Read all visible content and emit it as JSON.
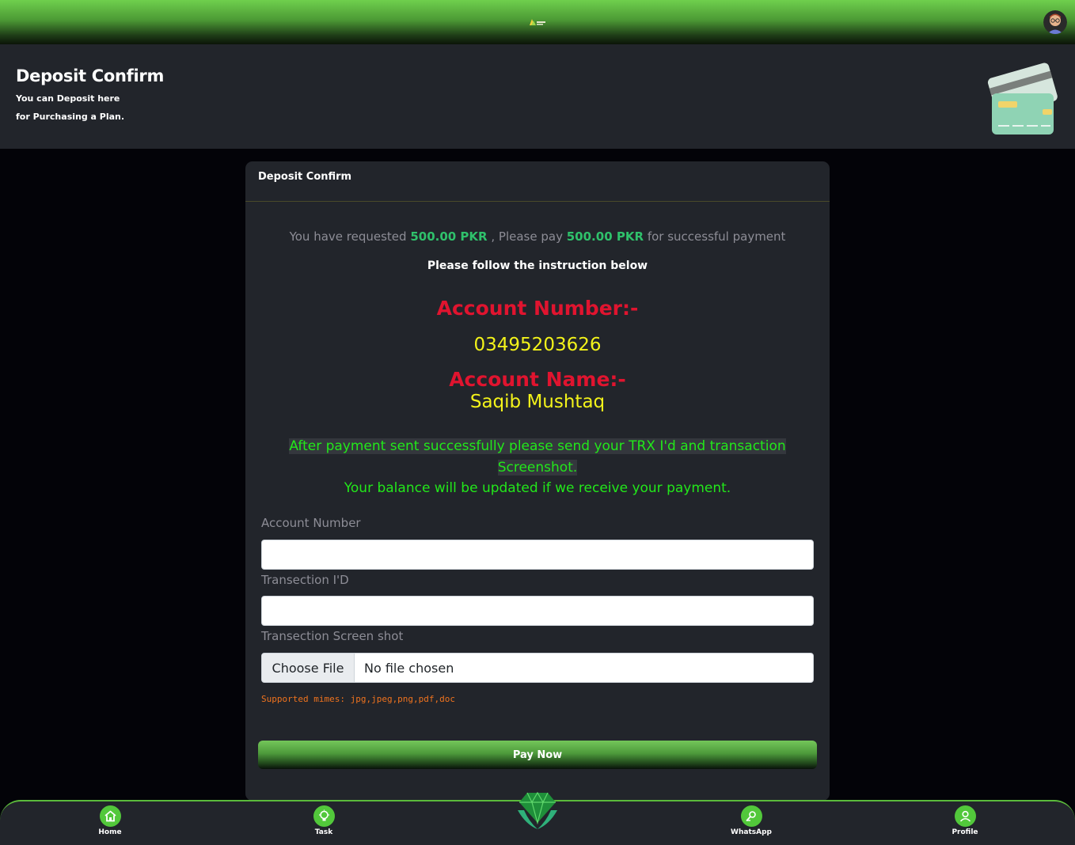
{
  "header": {
    "logo_icon": "brand-logo-icon",
    "avatar_icon": "user-avatar-icon",
    "accent_color": "#5cb83f"
  },
  "banner": {
    "title": "Deposit Confirm",
    "subtitle_line1": "You can Deposit here",
    "subtitle_line2": "for Purchasing a Plan.",
    "illustration_icon": "credit-card-icon"
  },
  "panel": {
    "title": "Deposit Confirm",
    "request": {
      "prefix": "You have requested",
      "requested_amount": "500.00 PKR",
      "middle": ", Please pay",
      "pay_amount": "500.00 PKR",
      "suffix": "for successful payment"
    },
    "instruction": "Please follow the instruction below",
    "account_number_label": "Account Number:-",
    "account_number_value": "03495203626",
    "account_name_label": "Account Name:-",
    "account_name_value": "Saqib Mushtaq",
    "note_line1": "After payment sent successfully please send your TRX I'd and transaction",
    "note_line2": "Screenshot.",
    "note_line3": "Your balance will be updated if we receive your payment."
  },
  "form": {
    "account_number_label": "Account Number",
    "account_number_value": "",
    "transaction_id_label": "Transection I'D",
    "transaction_id_value": "",
    "screenshot_label": "Transection Screen shot",
    "file_button": "Choose File",
    "file_status": "No file chosen",
    "supported_mimes": "Supported mimes: jpg,jpeg,png,pdf,doc",
    "submit_label": "Pay Now"
  },
  "bottom_nav": {
    "items": [
      {
        "label": "Home",
        "icon": "home-icon"
      },
      {
        "label": "Task",
        "icon": "lightbulb-icon"
      },
      {
        "label": "WhatsApp",
        "icon": "whatsapp-icon"
      },
      {
        "label": "Profile",
        "icon": "profile-icon"
      }
    ],
    "center_icon": "diamond-icon"
  }
}
